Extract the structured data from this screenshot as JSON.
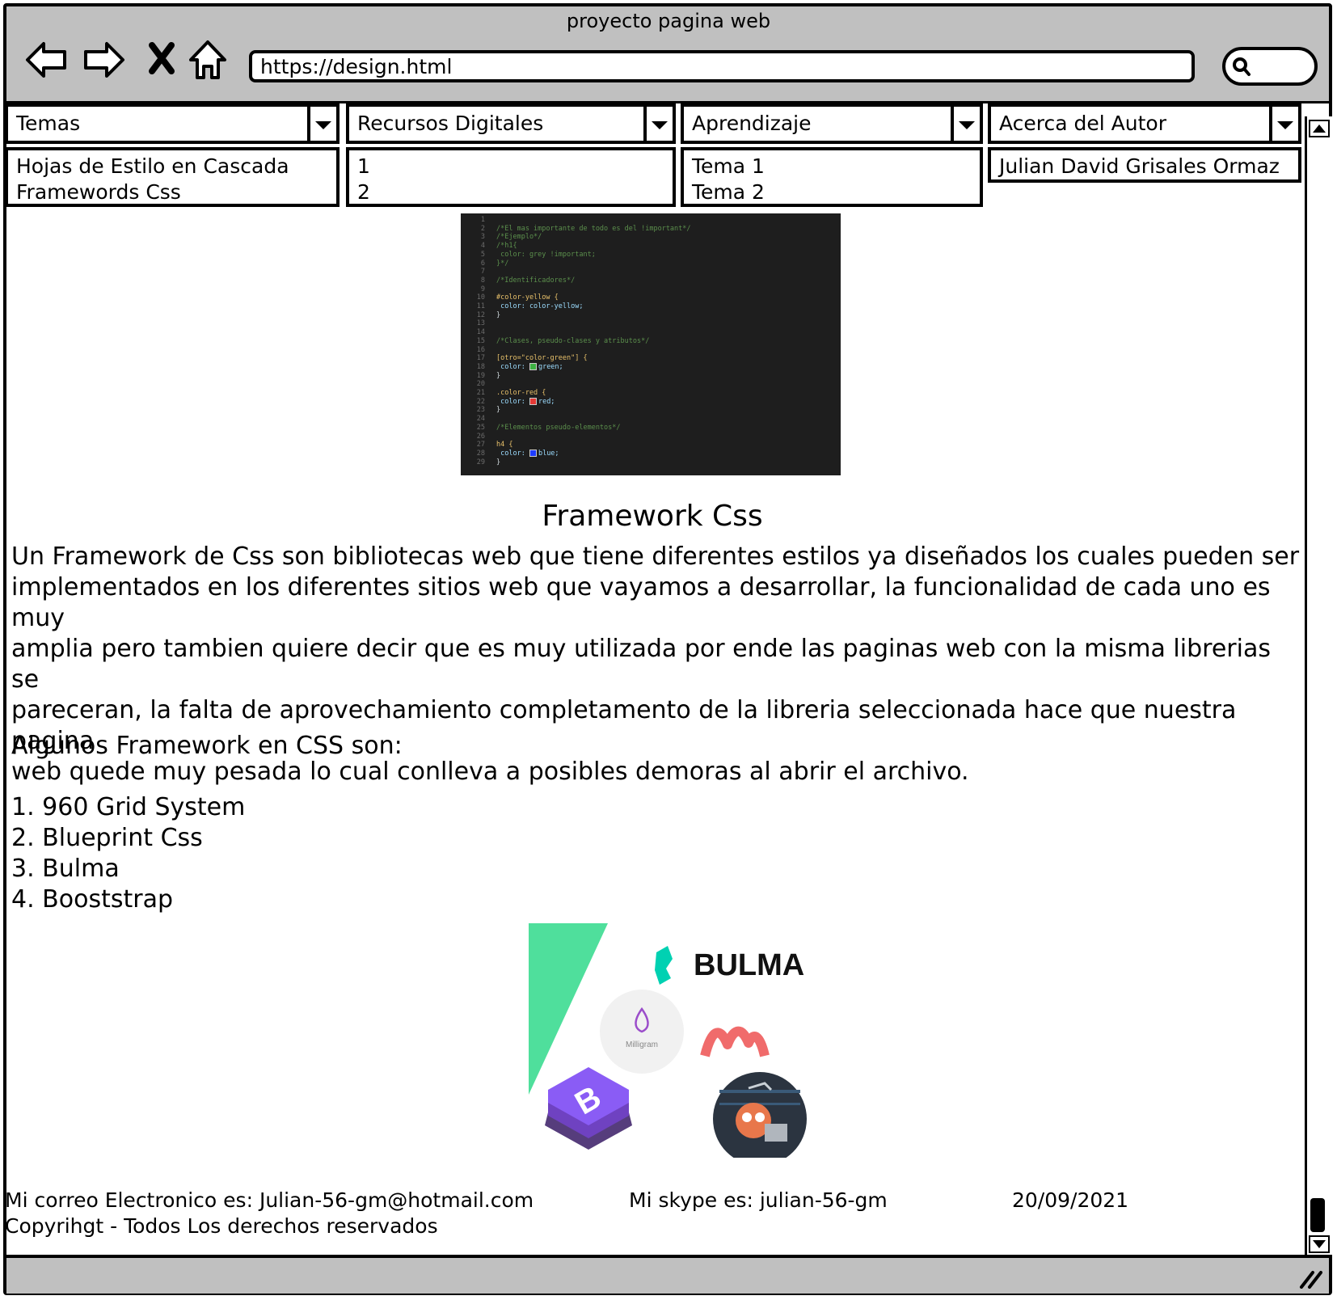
{
  "window": {
    "title": "proyecto pagina web"
  },
  "toolbar": {
    "url": "https://design.html",
    "icons": [
      "back-arrow-icon",
      "forward-arrow-icon",
      "close-x-icon",
      "home-icon",
      "search-icon"
    ]
  },
  "menus": [
    {
      "label": "Temas",
      "items": [
        "Hojas de Estilo en Cascada",
        "Framewords Css"
      ]
    },
    {
      "label": "Recursos Digitales",
      "items": [
        "1",
        "2"
      ]
    },
    {
      "label": "Aprendizaje",
      "items": [
        "Tema 1",
        "Tema 2"
      ]
    },
    {
      "label": "Acerca del Autor",
      "items": [
        "Julian David Grisales Ormaz"
      ]
    }
  ],
  "code_image": {
    "lines": [
      {
        "n": "1",
        "t": ""
      },
      {
        "n": "2",
        "t": "/*El mas importante de todo es del !important*/",
        "c": "cm"
      },
      {
        "n": "3",
        "t": "/*Ejemplo*/",
        "c": "cm"
      },
      {
        "n": "4",
        "t": "/*h1{",
        "c": "cm"
      },
      {
        "n": "5",
        "t": "    color: grey !important;",
        "c": "cm"
      },
      {
        "n": "6",
        "t": "}*/",
        "c": "cm"
      },
      {
        "n": "7",
        "t": ""
      },
      {
        "n": "8",
        "t": "/*Identificadores*/",
        "c": "cm"
      },
      {
        "n": "9",
        "t": ""
      },
      {
        "n": "10",
        "t": "#color-yellow {",
        "c": "sel"
      },
      {
        "n": "11",
        "t": "    color: color-yellow;",
        "c": "pr"
      },
      {
        "n": "12",
        "t": "}"
      },
      {
        "n": "13",
        "t": ""
      },
      {
        "n": "14",
        "t": ""
      },
      {
        "n": "15",
        "t": "/*Clases, pseudo-clases y atributos*/",
        "c": "cm"
      },
      {
        "n": "16",
        "t": ""
      },
      {
        "n": "17",
        "t": "[otro=\"color-green\"] {",
        "c": "sel"
      },
      {
        "n": "18",
        "t": "    color:  green;",
        "c": "pr",
        "sw": "#3cb043"
      },
      {
        "n": "19",
        "t": "}"
      },
      {
        "n": "20",
        "t": ""
      },
      {
        "n": "21",
        "t": ".color-red {",
        "c": "sel"
      },
      {
        "n": "22",
        "t": "    color: red;",
        "c": "pr",
        "sw": "#e53935"
      },
      {
        "n": "23",
        "t": "}"
      },
      {
        "n": "24",
        "t": ""
      },
      {
        "n": "25",
        "t": "/*Elementos pseudo-elementos*/",
        "c": "cm"
      },
      {
        "n": "26",
        "t": ""
      },
      {
        "n": "27",
        "t": "h4 {",
        "c": "sel"
      },
      {
        "n": "28",
        "t": "    color: blue;",
        "c": "pr",
        "sw": "#1e3cff"
      },
      {
        "n": "29",
        "t": "}"
      }
    ]
  },
  "article": {
    "heading": "Framework Css",
    "paragraph": [
      "Un Framework de Css son bibliotecas web que tiene diferentes estilos ya diseñados los cuales pueden ser",
      "implementados en los diferentes sitios web que vayamos a desarrollar, la funcionalidad de cada uno es muy",
      "amplia pero tambien quiere decir que es muy utilizada por ende las paginas web con la misma librerias se",
      "pareceran, la falta de aprovechamiento completamento de la libreria seleccionada hace que nuestra pagina",
      "web quede muy pesada lo cual conlleva a posibles demoras al abrir el archivo."
    ],
    "list_intro": "Algunos Framework en CSS son:",
    "list": [
      "1. 960 Grid System",
      "2. Blueprint Css",
      "3. Bulma",
      "4. Booststrap"
    ]
  },
  "logos": {
    "bulma": "BULMA",
    "milligram": "Milligram",
    "bootstrap": "B"
  },
  "footer": {
    "email": "Mi correo Electronico es: Julian-56-gm@hotmail.com",
    "skype": "Mi skype es: julian-56-gm",
    "date": "20/09/2021",
    "copyright": "Copyrihgt - Todos Los derechos reservados"
  },
  "colors": {
    "chrome": "#c0c0c0",
    "bulma_green": "#4fdf9c",
    "bootstrap_purple": "#7952b3",
    "code_bg": "#1e1e1e"
  }
}
